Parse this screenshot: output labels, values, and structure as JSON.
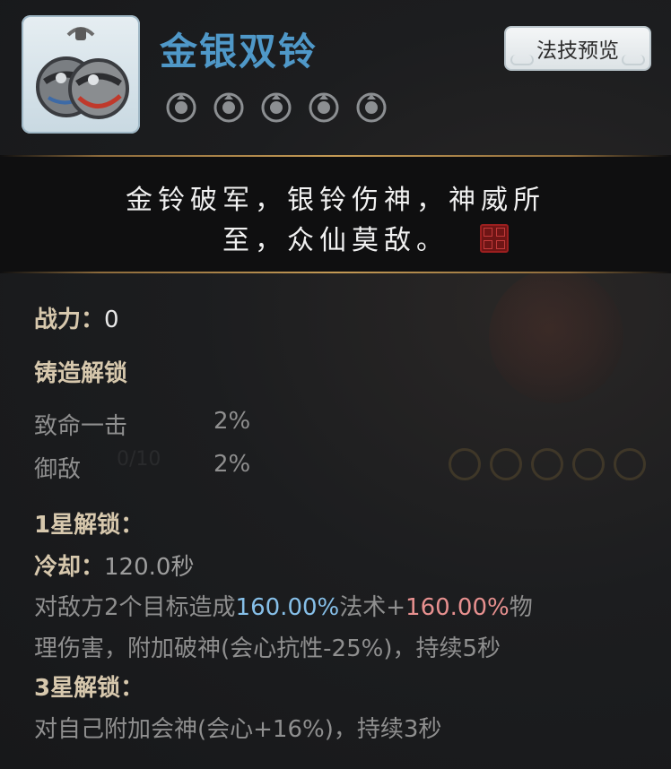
{
  "item": {
    "name": "金银双铃",
    "icon": "twin-bells-icon",
    "stars_total": 5,
    "stars_filled": 0
  },
  "header": {
    "preview_button": "法技预览"
  },
  "quote": {
    "line1": "金铃破军，银铃伤神，神威所",
    "line2": "至，众仙莫敌。"
  },
  "stats": {
    "power_label": "战力：",
    "power_value": "0",
    "forge_title": "铸造解锁",
    "forge_stats": [
      {
        "name": "致命一击",
        "value": "2%"
      },
      {
        "name": "御敌",
        "value": "2%"
      }
    ]
  },
  "star1": {
    "title": "1星解锁：",
    "cooldown_label": "冷却：",
    "cooldown_value": "120.0秒",
    "desc_prefix": "对敌方2个目标造成",
    "magic_pct": "160.00%",
    "desc_mid": "法术+",
    "phys_pct": "160.00%",
    "desc_line1_tail": "物",
    "desc_line2": "理伤害，附加破神(会心抗性-25%)，持续5秒"
  },
  "star3": {
    "title": "3星解锁：",
    "desc": "对自己附加会神(会心+16%)，持续3秒"
  },
  "background_text": {
    "progress": "0/10"
  },
  "colors": {
    "title": "#4f98c8",
    "magic": "#86bfe8",
    "physical": "#e7908f",
    "gold_rule": "#c49a55"
  }
}
